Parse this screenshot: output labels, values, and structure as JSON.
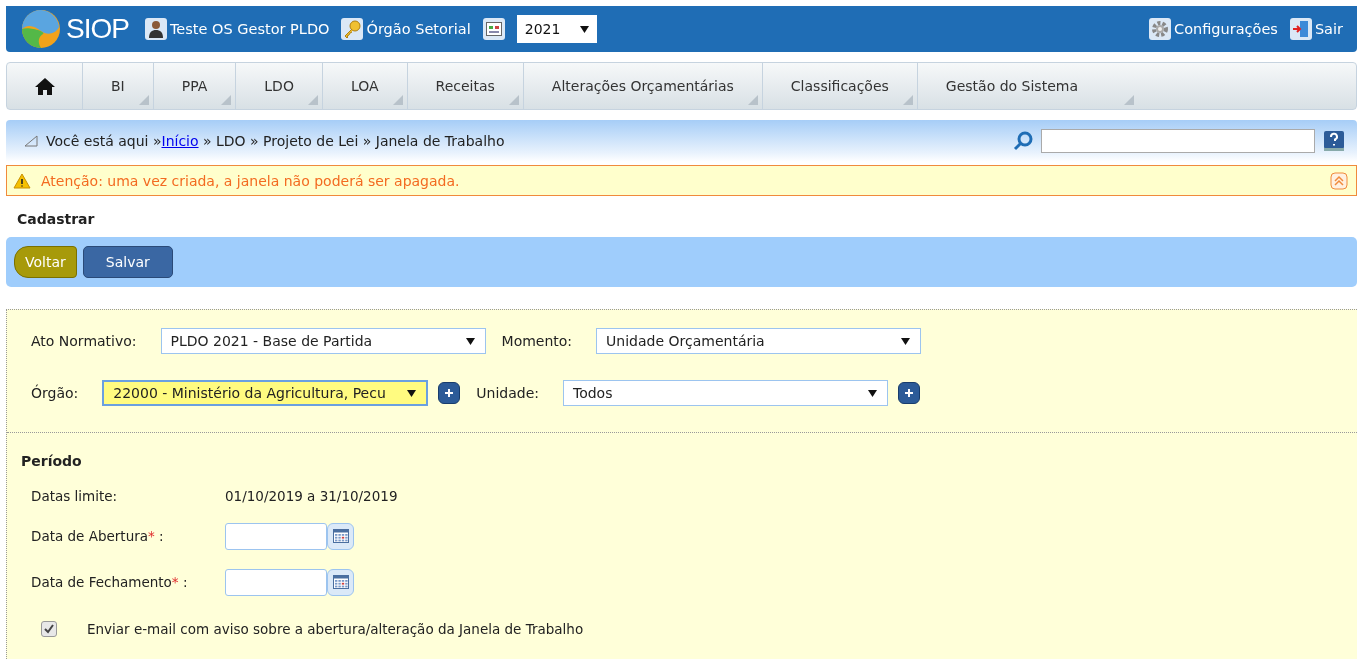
{
  "header": {
    "brand": "SIOP",
    "user": "Teste OS Gestor PLDO",
    "profile": "Órgão Setorial",
    "year": "2021",
    "settings": "Configurações",
    "logout": "Sair"
  },
  "menu": [
    {
      "label": "BI"
    },
    {
      "label": "PPA"
    },
    {
      "label": "LDO"
    },
    {
      "label": "LOA"
    },
    {
      "label": "Receitas"
    },
    {
      "label": "Alterações Orçamentárias"
    },
    {
      "label": "Classificações"
    },
    {
      "label": "Gestão do Sistema"
    }
  ],
  "breadcrumb": {
    "prefix": "Você está aqui »",
    "link": "Início",
    "rest": " » LDO » Projeto de Lei » Janela de Trabalho"
  },
  "alert": {
    "text": "Atenção: uma vez criada, a janela não poderá ser apagada."
  },
  "section_title": "Cadastrar",
  "buttons": [
    {
      "label": "Voltar",
      "kind": "back"
    },
    {
      "label": "Salvar",
      "kind": "primary"
    }
  ],
  "filters": [
    {
      "label": "Ato Normativo:",
      "value": "PLDO 2021 - Base de Partida",
      "highlighted": false,
      "add": false
    },
    {
      "label": "Momento:",
      "value": "Unidade Orçamentária",
      "highlighted": false,
      "add": false
    },
    {
      "label": "Órgão:",
      "value": "22000 - Ministério da Agricultura, Pecu",
      "highlighted": true,
      "add": true
    },
    {
      "label": "Unidade:",
      "value": "Todos",
      "highlighted": false,
      "add": true
    }
  ],
  "period": {
    "title": "Período",
    "limit_label": "Datas limite:",
    "limit_value": "01/10/2019 a 31/10/2019",
    "dates": [
      {
        "label": "Data de Abertura",
        "required_mark": "*",
        "suffix": " :"
      },
      {
        "label": "Data de Fechamento",
        "required_mark": "*",
        "suffix": " :"
      }
    ],
    "email": {
      "label": "Enviar e-mail com aviso sobre a abertura/alteração da Janela de Trabalho",
      "checked": true
    }
  }
}
